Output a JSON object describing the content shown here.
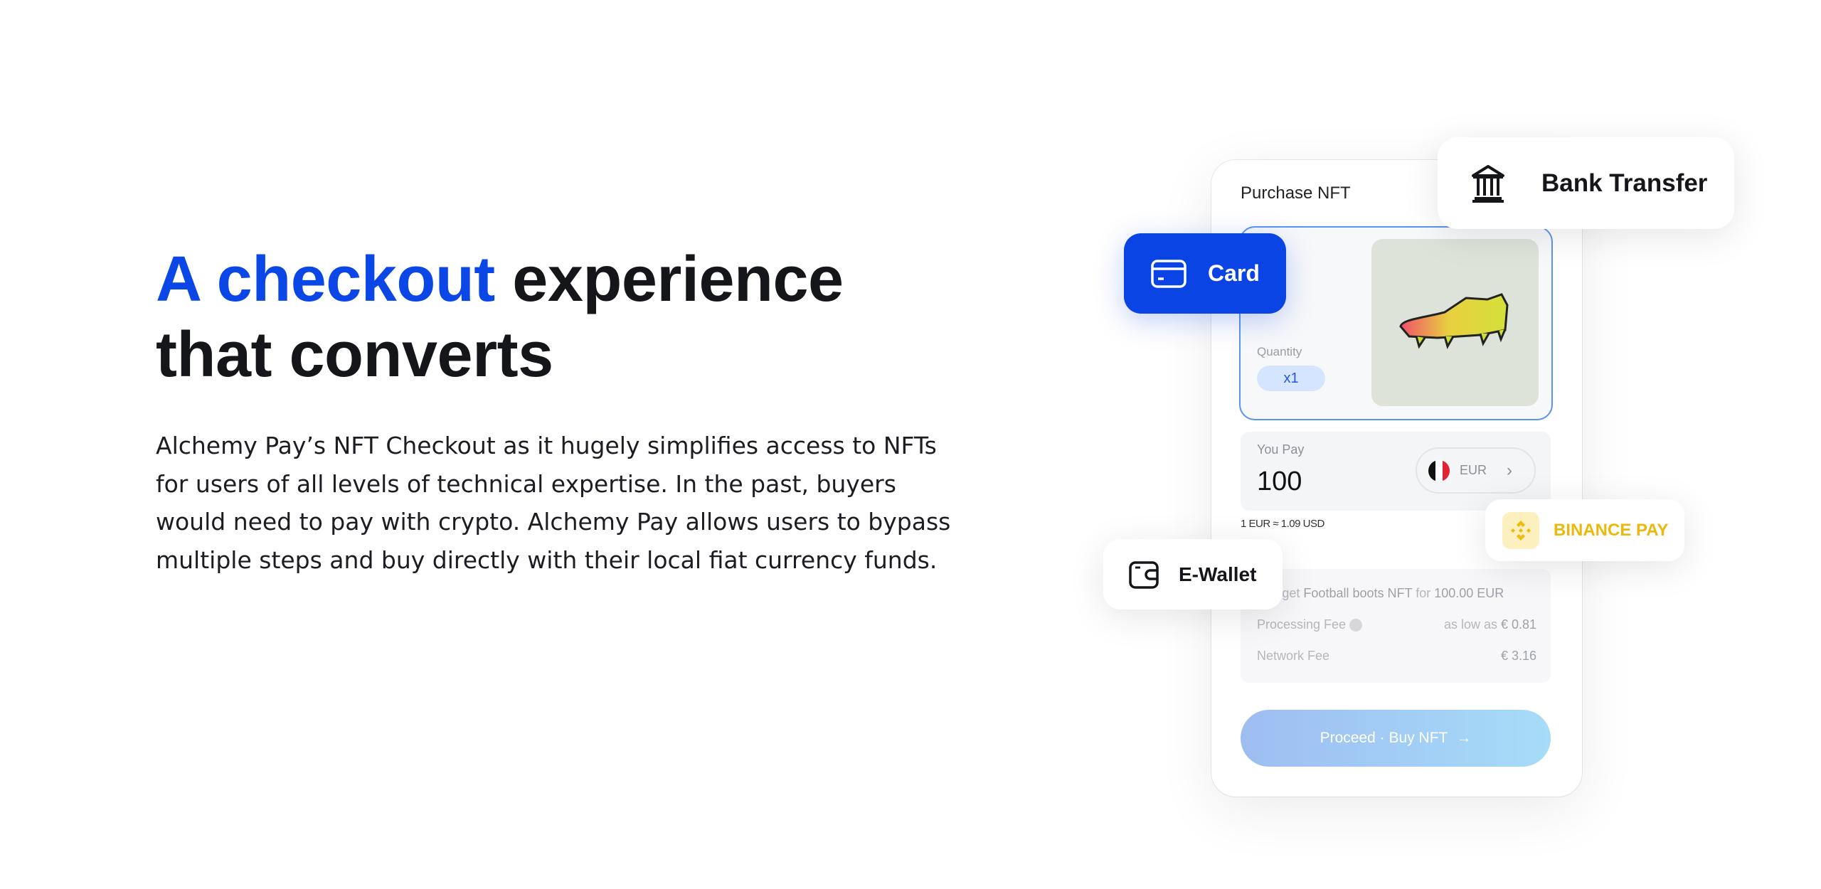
{
  "hero": {
    "heading_accent": "A checkout",
    "heading_rest": " experience",
    "heading_line2": "that converts",
    "paragraph": "Alchemy Pay’s NFT Checkout as it hugely simplifies access to NFTs for users of all levels of technical expertise. In the past, buyers would need to pay with crypto. Alchemy Pay allows users to bypass multiple steps and buy directly with their local fiat currency funds.",
    "accent_color": "#0a47e6"
  },
  "checkout": {
    "title": "Purchase NFT",
    "quantity_label": "Quantity",
    "quantity_value": "x1",
    "you_pay_label": "You Pay",
    "amount": "100",
    "currency": "EUR",
    "rate": "1 EUR ≈ 1.09 USD",
    "summary_prefix": "You get",
    "summary_item": "Football boots NFT",
    "summary_for": "for",
    "summary_total": "100.00 EUR",
    "processing_fee_label": "Processing Fee",
    "processing_fee_note": "as low as",
    "processing_fee_value": "€ 0.81",
    "network_fee_label": "Network Fee",
    "network_fee_value": "€ 3.16",
    "proceed_label": "Proceed · Buy NFT"
  },
  "methods": {
    "bank": "Bank Transfer",
    "card": "Card",
    "binance": "BINANCE PAY",
    "ewallet": "E-Wallet"
  }
}
